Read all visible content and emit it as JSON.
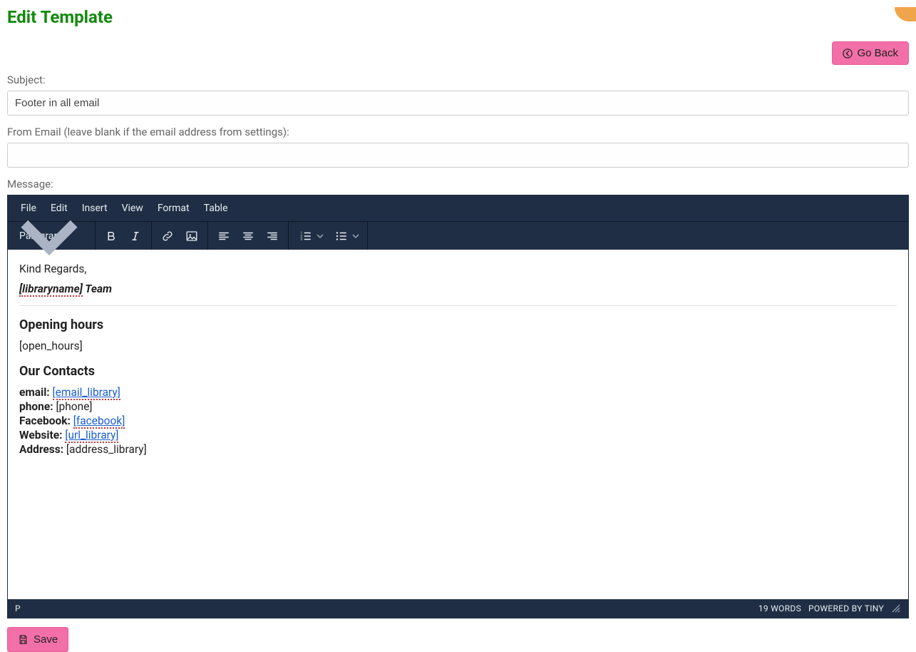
{
  "page": {
    "title": "Edit Template"
  },
  "buttons": {
    "go_back": "Go Back",
    "save": "Save"
  },
  "labels": {
    "subject": "Subject:",
    "from_email": "From Email (leave blank if the email address from settings):",
    "message": "Message:"
  },
  "fields": {
    "subject_value": "Footer in all email",
    "from_email_value": ""
  },
  "editor": {
    "menubar": [
      "File",
      "Edit",
      "Insert",
      "View",
      "Format",
      "Table"
    ],
    "block_format": "Paragraph",
    "status_path": "P",
    "word_count": "19 WORDS",
    "powered_by": "POWERED BY TINY",
    "content": {
      "greeting": "Kind Regards,",
      "libraryname_token": "[libraryname]",
      "team_suffix": " Team",
      "opening_hours_heading": "Opening hours",
      "open_hours_token": "[open_hours]",
      "contacts_heading": "Our Contacts",
      "contacts": {
        "email_label": "email:",
        "email_value": "[email_library]",
        "phone_label": "phone:",
        "phone_value": "[phone]",
        "facebook_label": "Facebook:",
        "facebook_value": "[facebook]",
        "website_label": "Website:",
        "website_value": "[url_library]",
        "address_label": "Address:",
        "address_value": "[address_library]"
      }
    }
  }
}
